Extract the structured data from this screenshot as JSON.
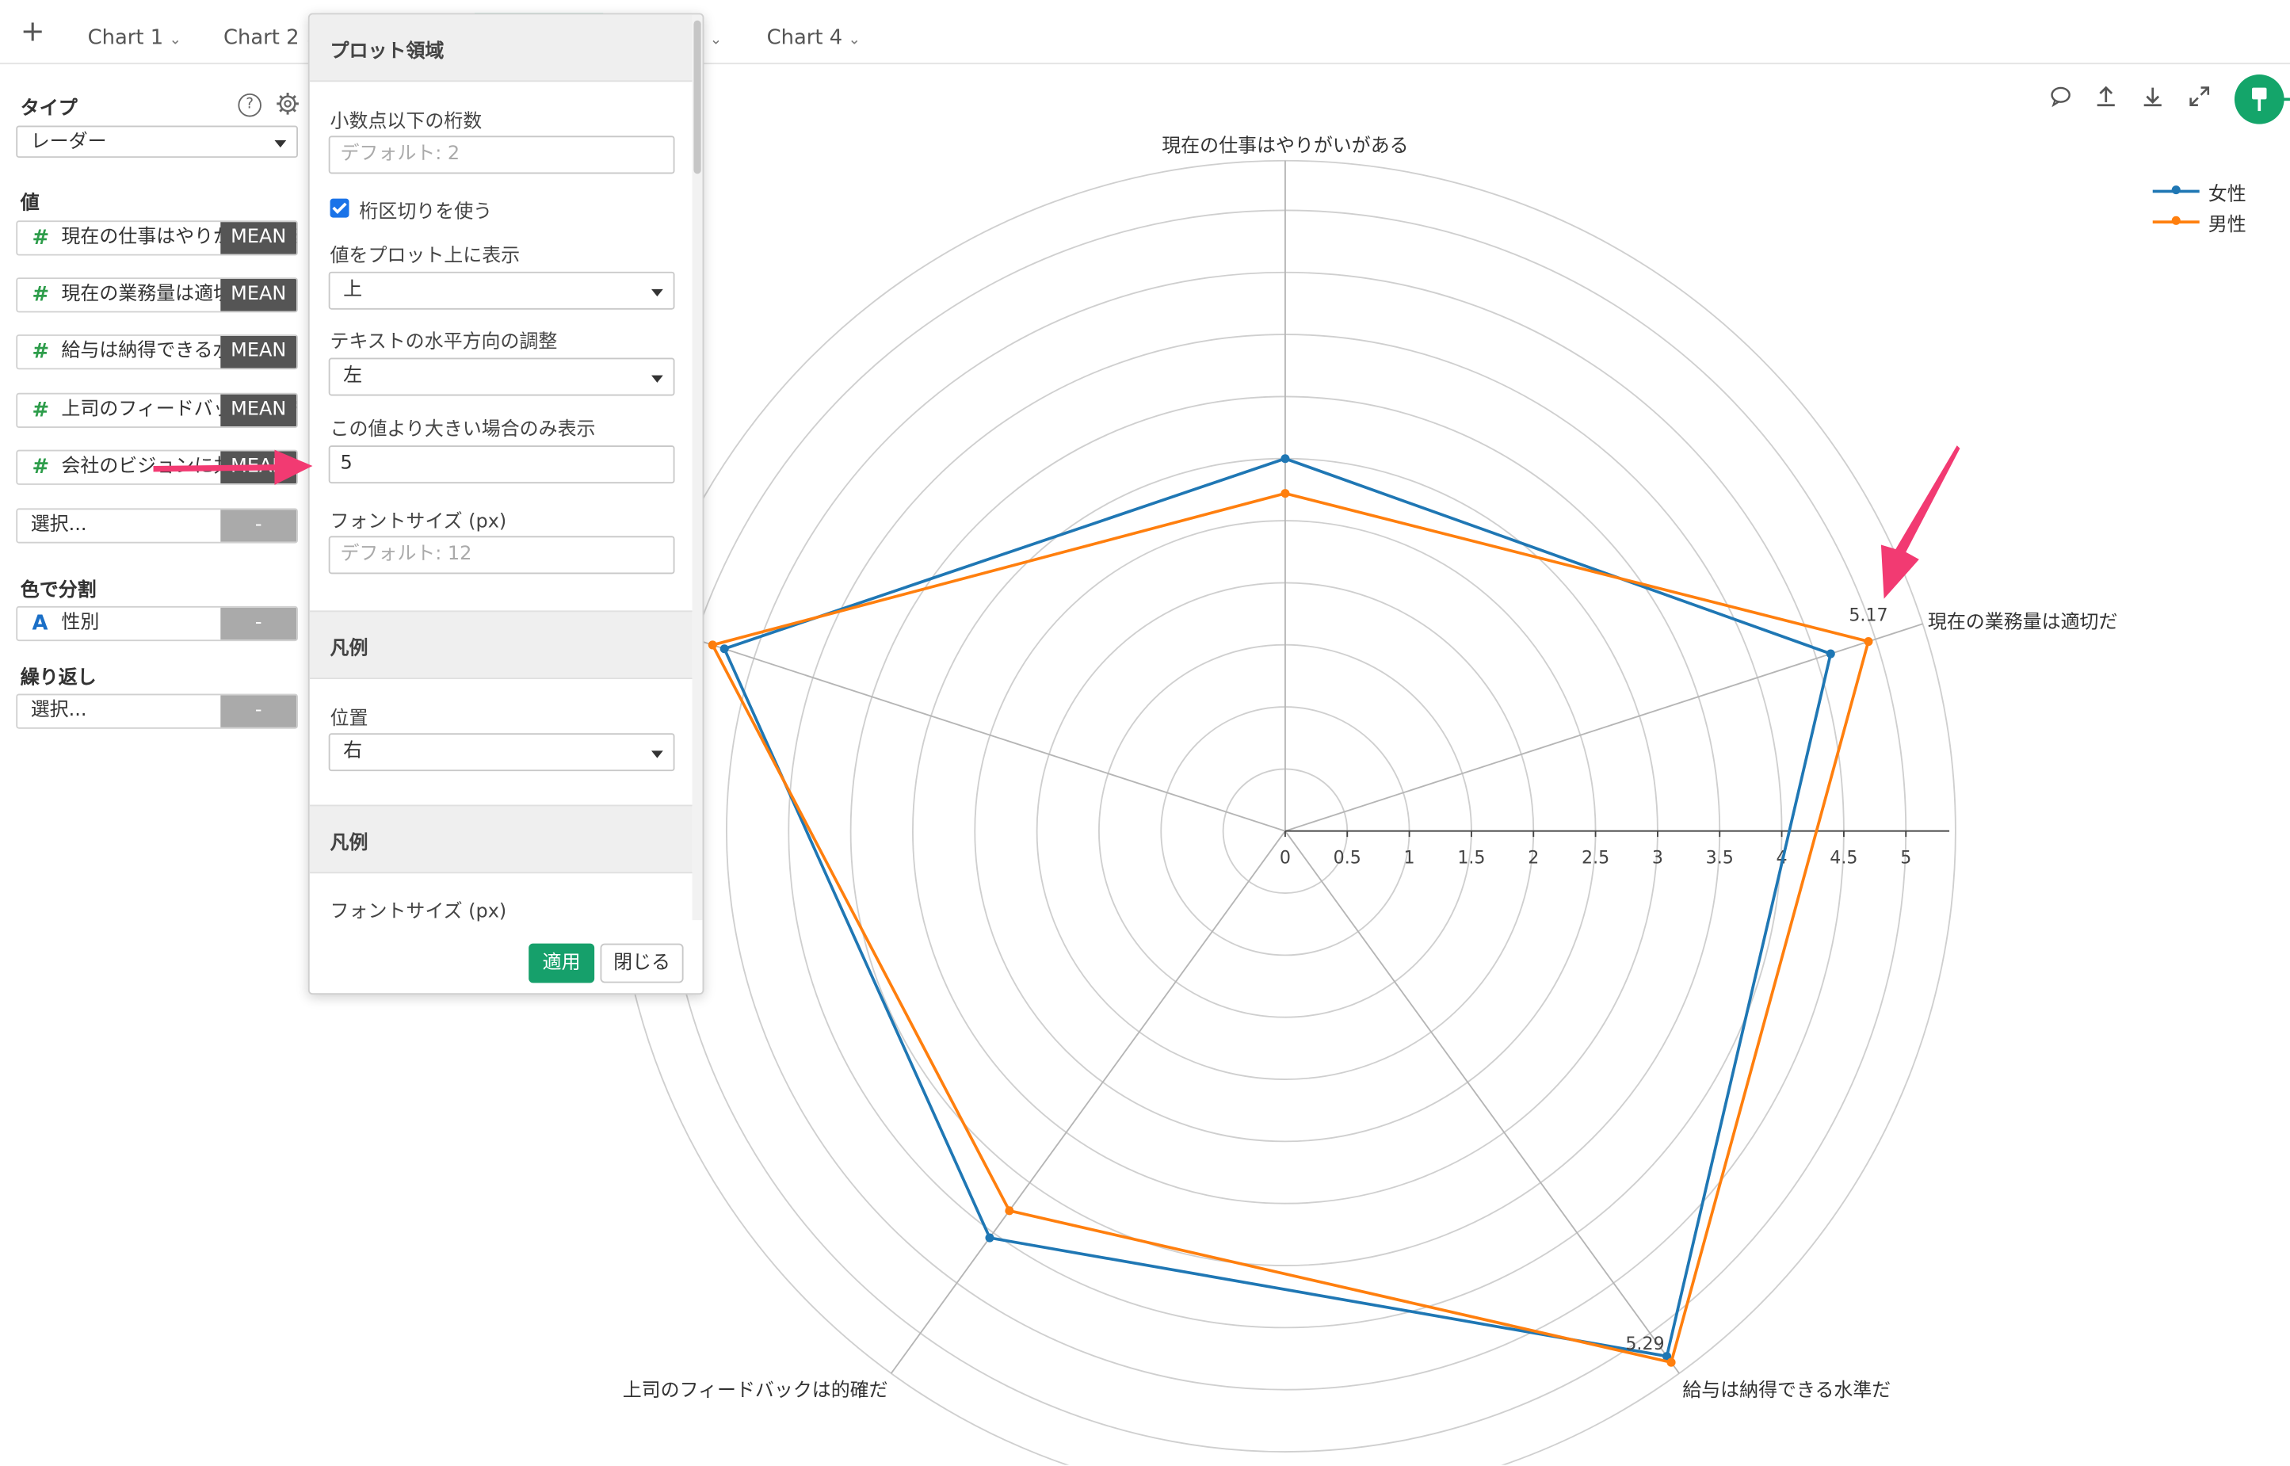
{
  "tabs": {
    "add": "+",
    "items": [
      {
        "label": "Chart 1",
        "chev": "⌄"
      },
      {
        "label": "Chart 2",
        "chev": "⌄"
      },
      {
        "label": "Chart 4",
        "chev": "⌄"
      }
    ],
    "hidden_chev": "⌄"
  },
  "sidebar": {
    "type_title": "タイプ",
    "help_icon": "?",
    "type_value": "レーダー",
    "values_title": "値",
    "fields": [
      {
        "text": "現在の仕事はやりがいがある",
        "agg": "MEAN"
      },
      {
        "text": "現在の業務量は適切だ",
        "agg": "MEAN"
      },
      {
        "text": "給与は納得できる水準だ",
        "agg": "MEAN"
      },
      {
        "text": "上司のフィードバックは的確だ",
        "agg": "MEAN"
      },
      {
        "text": "会社のビジョンに共感できる",
        "agg": "MEAN"
      }
    ],
    "select_placeholder": "選択...",
    "dash": "-",
    "color_split_title": "色で分割",
    "color_split_value": "性別",
    "repeat_title": "繰り返し",
    "repeat_placeholder": "選択..."
  },
  "popup": {
    "section1_title": "プロット領域",
    "decimals_label": "小数点以下の桁数",
    "decimals_placeholder": "デフォルト: 2",
    "separator_label": "桁区切りを使う",
    "show_values_label": "値をプロット上に表示",
    "show_values_value": "上",
    "text_align_label": "テキストの水平方向の調整",
    "text_align_value": "左",
    "threshold_label": "この値より大きい場合のみ表示",
    "threshold_value": "5",
    "fontsize_label": "フォントサイズ (px)",
    "fontsize_placeholder": "デフォルト: 12",
    "section2_title": "凡例",
    "position_label": "位置",
    "position_value": "右",
    "section3_title": "凡例",
    "fontsize2_label": "フォントサイズ (px)",
    "apply": "適用",
    "close": "閉じる"
  },
  "toolbar": {
    "icons": [
      "comment-icon",
      "upload-icon",
      "download-icon",
      "expand-icon",
      "pin-icon"
    ]
  },
  "colors": {
    "female": "#1f77b4",
    "male": "#ff7f0e",
    "accent": "#14a56a",
    "arrow": "#f23a72"
  },
  "chart_data": {
    "type": "radar",
    "axes": [
      "現在の仕事はやりがいがある",
      "現在の業務量は適切だ",
      "給与は納得できる水準だ",
      "上司のフィードバックは的確だ",
      "会社のビジョンに共感できる"
    ],
    "radial_ticks": [
      "0",
      "0.5",
      "1",
      "1.5",
      "2",
      "2.5",
      "3",
      "3.5",
      "4",
      "4.5",
      "5"
    ],
    "r_range": [
      0,
      5.4
    ],
    "series": [
      {
        "name": "女性",
        "values": [
          3.0,
          4.62,
          5.23,
          4.05,
          4.75
        ]
      },
      {
        "name": "男性",
        "values": [
          2.72,
          4.94,
          5.29,
          3.78,
          4.85
        ]
      }
    ],
    "data_labels": {
      "show_above": 5,
      "values": [
        "5.17",
        "5.29"
      ]
    },
    "legend_position": "top-right",
    "grid": true
  }
}
